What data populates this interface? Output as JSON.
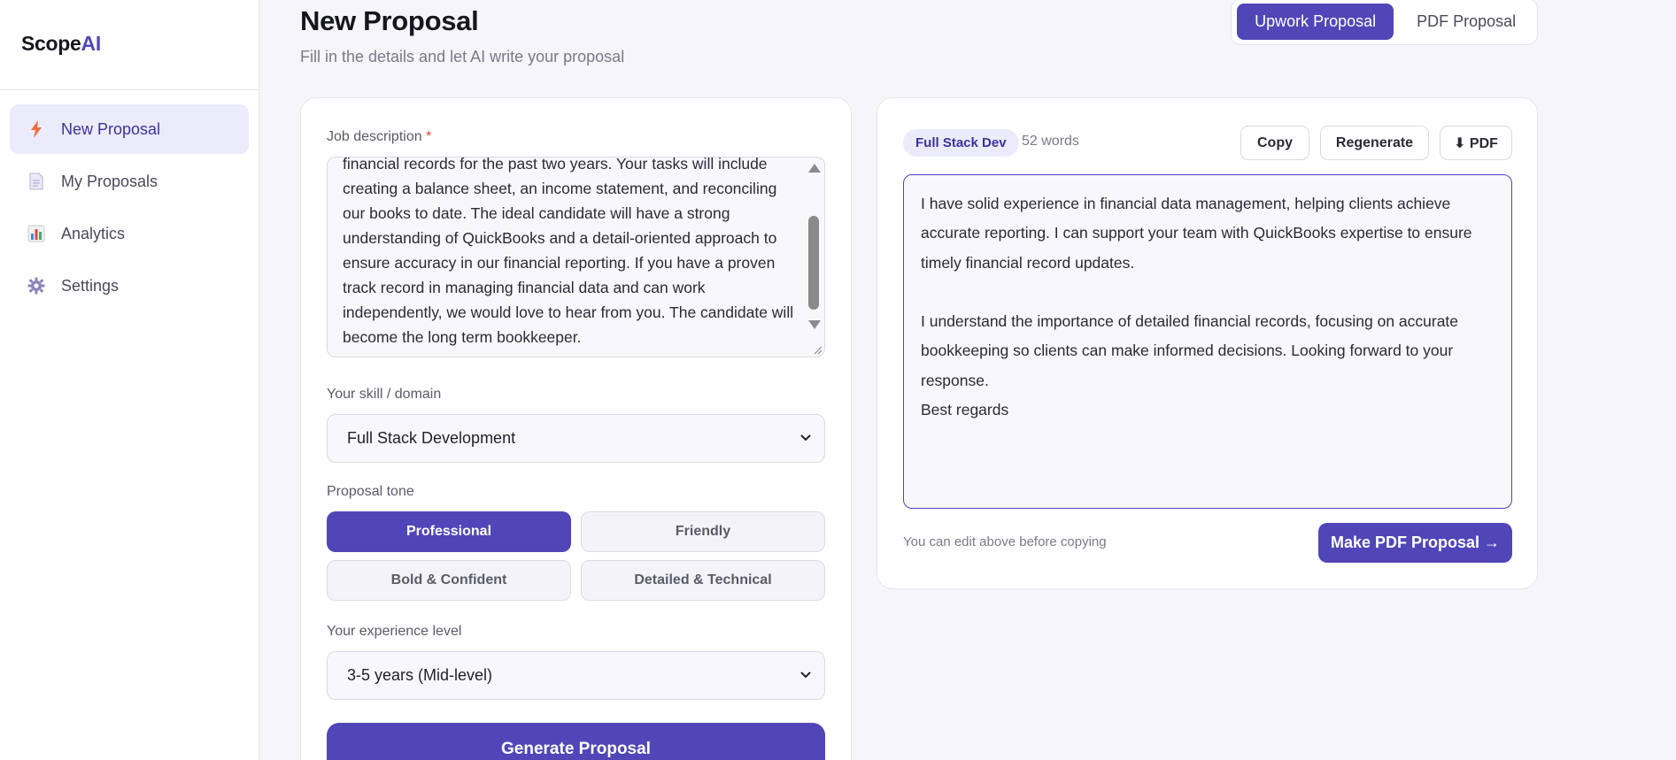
{
  "app": {
    "logo_main": "Scope",
    "logo_accent": "AI"
  },
  "sidebar": {
    "items": [
      {
        "label": "New Proposal",
        "icon": "lightning-icon",
        "active": true
      },
      {
        "label": "My Proposals",
        "icon": "document-icon",
        "active": false
      },
      {
        "label": "Analytics",
        "icon": "bar-chart-icon",
        "active": false
      },
      {
        "label": "Settings",
        "icon": "gear-icon",
        "active": false
      }
    ]
  },
  "header": {
    "title": "New Proposal",
    "subtitle": "Fill in the details and let AI write your proposal",
    "modes": [
      {
        "label": "Upwork Proposal",
        "active": true
      },
      {
        "label": "PDF Proposal",
        "active": false
      }
    ]
  },
  "form": {
    "job_description_label": "Job description",
    "required_marker": "*",
    "job_description_value": "financial records for the past two years. Your tasks will include creating a balance sheet, an income statement, and reconciling our books to date. The ideal candidate will have a strong understanding of QuickBooks and a detail-oriented approach to ensure accuracy in our financial reporting. If you have a proven track record in managing financial data and can work independently, we would love to hear from you. The candidate will become the long term bookkeeper.",
    "skill_label": "Your skill / domain",
    "skill_value": "Full Stack Development",
    "tone_label": "Proposal tone",
    "tones": [
      {
        "label": "Professional",
        "active": true
      },
      {
        "label": "Friendly",
        "active": false
      },
      {
        "label": "Bold & Confident",
        "active": false
      },
      {
        "label": "Detailed & Technical",
        "active": false
      }
    ],
    "experience_label": "Your experience level",
    "experience_value": "3-5 years (Mid-level)",
    "generate_label": "Generate Proposal"
  },
  "output": {
    "skill_badge": "Full Stack Dev",
    "word_count": "52 words",
    "copy_label": "Copy",
    "regenerate_label": "Regenerate",
    "pdf_download_label": "⬇ PDF",
    "proposal_text": "I have solid experience in financial data management, helping clients achieve accurate reporting. I can support your team with QuickBooks expertise to ensure timely financial record updates.\n\nI understand the importance of detailed financial records, focusing on accurate bookkeeping so clients can make informed decisions. Looking forward to your response.\nBest regards",
    "edit_hint": "You can edit above before copying",
    "make_pdf_label": "Make PDF Proposal →"
  },
  "colors": {
    "accent": "#5046b8",
    "accent_light": "#ecebfb",
    "required": "#e0453a"
  }
}
